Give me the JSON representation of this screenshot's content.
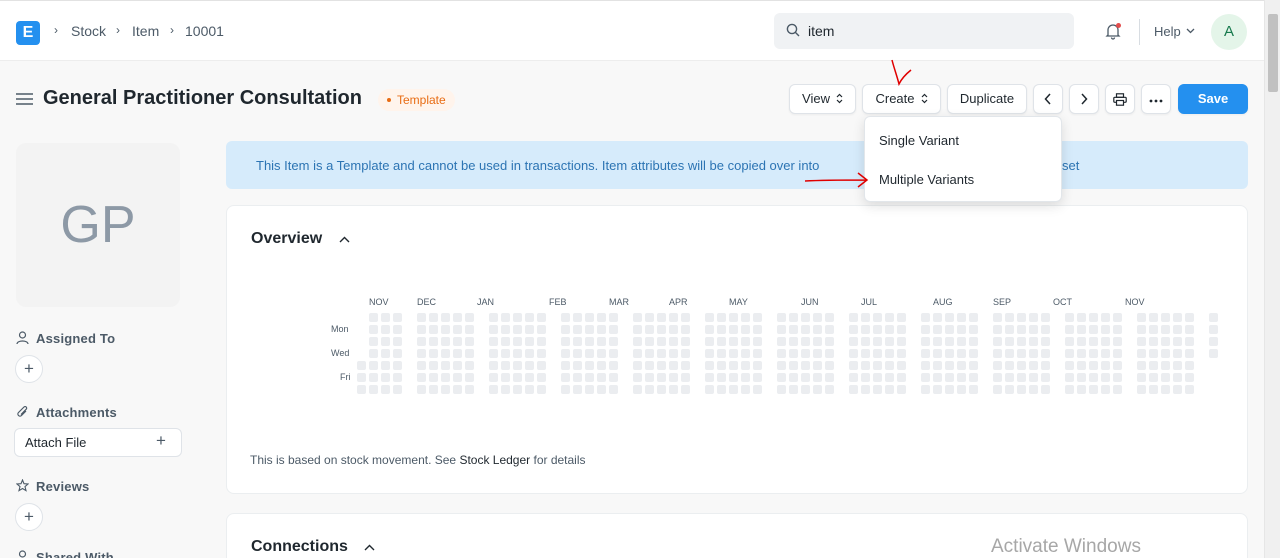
{
  "navbar": {
    "logo_letter": "E",
    "breadcrumbs": [
      "Stock",
      "Item",
      "10001"
    ],
    "search_value": "item",
    "help_label": "Help",
    "avatar_letter": "A"
  },
  "page": {
    "title": "General Practitioner Consultation",
    "status": "Template"
  },
  "toolbar": {
    "view_label": "View",
    "create_label": "Create",
    "duplicate_label": "Duplicate",
    "save_label": "Save"
  },
  "create_menu": {
    "items": [
      "Single Variant",
      "Multiple Variants"
    ]
  },
  "sidebar": {
    "image_initials": "GP",
    "assigned_to_label": "Assigned To",
    "attachments_label": "Attachments",
    "attach_file_label": "Attach File",
    "reviews_label": "Reviews",
    "shared_with_label": "Shared With"
  },
  "banner": {
    "text_left": "This Item is a Template and cannot be used in transactions. Item attributes will be copied over into",
    "text_right": "set"
  },
  "overview": {
    "title": "Overview",
    "months": [
      "NOV",
      "DEC",
      "JAN",
      "FEB",
      "MAR",
      "APR",
      "MAY",
      "JUN",
      "JUL",
      "AUG",
      "SEP",
      "OCT",
      "NOV"
    ],
    "day_labels": [
      "Mon",
      "Wed",
      "Fri"
    ],
    "footer_prefix": "This is based on stock movement. See ",
    "footer_link": "Stock Ledger",
    "footer_suffix": " for details"
  },
  "connections": {
    "title": "Connections"
  },
  "watermark": "Activate Windows",
  "colors": {
    "primary": "#2490ef",
    "status_orange": "#e86c13",
    "banner_bg": "#d6ebfb",
    "heat_cell": "#ebedf0",
    "annotation_red": "#e00000"
  }
}
